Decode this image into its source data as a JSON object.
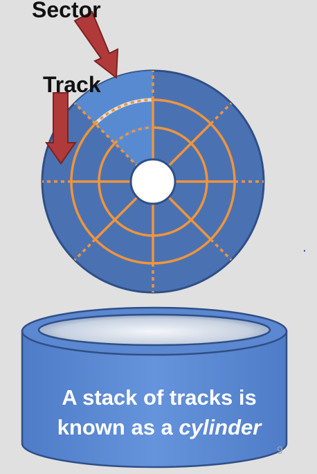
{
  "labels": {
    "sector": "Sector",
    "track": "Track"
  },
  "caption": {
    "line1": "A stack of tracks is",
    "line2_prefix": "known as a ",
    "line2_emphasis": "cylinder"
  },
  "page_number": "9",
  "colors": {
    "background": "#e0e0e0",
    "platter": "#4a72b3",
    "platter_edge": "#2f4f86",
    "sector_highlight": "#5b8ed6",
    "track_lines": "#f0953a",
    "arrow": "#b03a3a",
    "arrow_edge": "#7a2323",
    "cylinder_body": "#5b88d0",
    "cylinder_edge": "#2f4f86",
    "caption_text": "#ffffff"
  }
}
